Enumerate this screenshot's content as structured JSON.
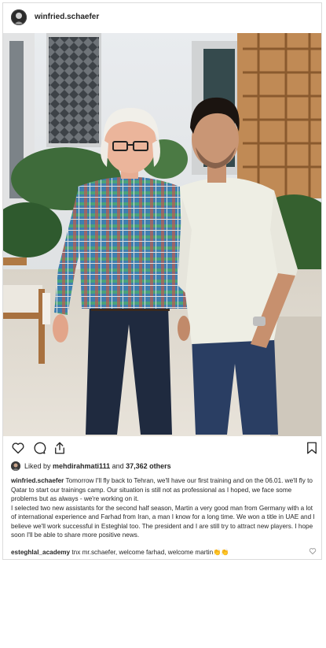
{
  "post": {
    "username": "winfried.schaefer",
    "likes": {
      "prefix": "Liked by ",
      "liker": "mehdirahmati111",
      "conjunction": " and ",
      "others": "37,362 others"
    },
    "caption": {
      "author": "winfried.schaefer",
      "paragraph1": " Tomorrow I'll fly back to Tehran, we'll have our first training and on the 06.01. we'll fly to Qatar to start our trainings camp. Our situation is still not as professional as I hoped, we face some problems but as always - we're working on it.",
      "paragraph2": "I selected two new assistants for the second half season, Martin a very good man from Germany with a lot of international experience and Farhad from Iran, a man I know for a long time. We won a title in UAE and I believe we'll work successful in Esteghlal too. The president and I are still try to attract new players. I hope soon I'll be able to share more positive news."
    },
    "comment": {
      "author": "esteghlal_academy",
      "text": " tnx mr.schaefer, welcome farhad, welcome martin",
      "emoji": "👏👏"
    }
  },
  "icons": [
    "heart-icon",
    "comment-icon",
    "share-icon",
    "bookmark-icon",
    "comment-like-icon"
  ],
  "colors": {
    "text": "#262626",
    "border": "#dbdbdb",
    "background": "#ffffff"
  }
}
